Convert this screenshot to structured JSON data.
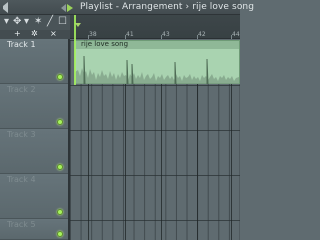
{
  "title_bar": {
    "title": "Playlist - Arrangement",
    "separator": "›",
    "song": "rije love song"
  },
  "toolbar": {
    "glyphs": [
      "▾",
      "✥",
      "▾",
      "✶",
      "╱",
      "☐"
    ],
    "sub_glyphs": [
      "+",
      "✲",
      "×"
    ]
  },
  "ruler": {
    "numbers": [
      "38",
      "41",
      "43",
      "42",
      "44"
    ]
  },
  "tracks": [
    {
      "name": "Track 1"
    },
    {
      "name": "Track 2"
    },
    {
      "name": "Track 3"
    },
    {
      "name": "Track 4"
    },
    {
      "name": "Track 5"
    }
  ],
  "clip": {
    "label": "rije love song"
  },
  "colors": {
    "accent": "#a7f35e",
    "clip": "#a9d3b0",
    "background": "#5f6b70"
  }
}
